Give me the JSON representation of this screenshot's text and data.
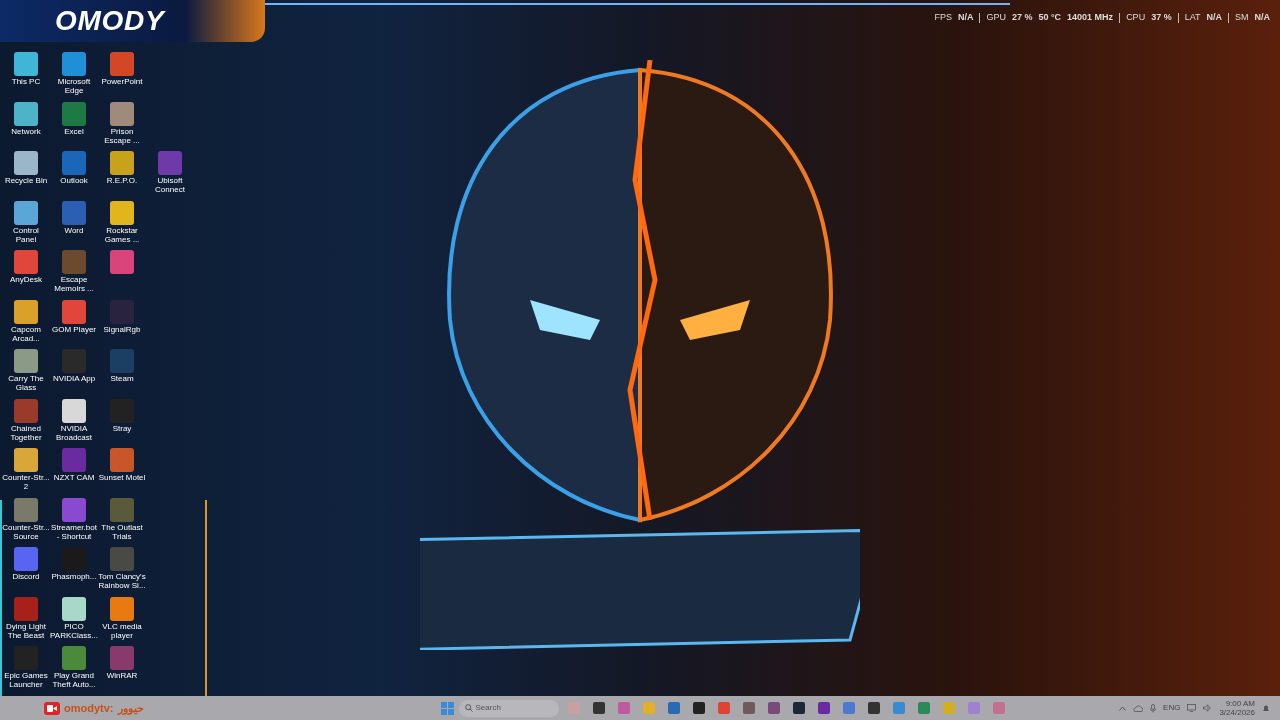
{
  "overlay_logo": {
    "text": "OMODY"
  },
  "stats": [
    {
      "label": "FPS",
      "values": [
        "N/A"
      ]
    },
    {
      "label": "GPU",
      "values": [
        "27 %",
        "50 °C",
        "14001 MHz"
      ]
    },
    {
      "label": "CPU",
      "values": [
        "37 %"
      ]
    },
    {
      "label": "LAT",
      "values": [
        "N/A"
      ]
    },
    {
      "label": "SM",
      "values": [
        "N/A"
      ]
    }
  ],
  "desktop_rows": [
    [
      {
        "label": "This PC",
        "color": "#3fb6d6"
      },
      {
        "label": "Microsoft Edge",
        "color": "#1f8fd6"
      },
      {
        "label": "PowerPoint",
        "color": "#d24726"
      }
    ],
    [
      {
        "label": "Network",
        "color": "#4cb3c9"
      },
      {
        "label": "Excel",
        "color": "#1d7a45"
      },
      {
        "label": "Prison Escape ...",
        "color": "#a08a7a"
      }
    ],
    [
      {
        "label": "Recycle Bin",
        "color": "#9ab6c8"
      },
      {
        "label": "Outlook",
        "color": "#1a66b8"
      },
      {
        "label": "R.E.P.O.",
        "color": "#c8a21a"
      },
      {
        "label": "Ubisoft Connect",
        "color": "#6e3aa8"
      }
    ],
    [
      {
        "label": "Control Panel",
        "color": "#5aa6d6"
      },
      {
        "label": "Word",
        "color": "#2b5fb4"
      },
      {
        "label": "Rockstar Games ...",
        "color": "#e3b51c"
      }
    ],
    [
      {
        "label": "AnyDesk",
        "color": "#e0473a"
      },
      {
        "label": "Escape Memoirs ...",
        "color": "#6b4a2e"
      },
      {
        "color": "#d9447a"
      }
    ],
    [
      {
        "label": "Capcom Arcad...",
        "color": "#d9a12a"
      },
      {
        "label": "GOM Player",
        "color": "#e2463a"
      },
      {
        "label": "SignalRgb",
        "color": "#2a2340"
      }
    ],
    [
      {
        "label": "Carry The Glass",
        "color": "#8a9a86"
      },
      {
        "label": "NVIDIA App",
        "color": "#2a2a2a"
      },
      {
        "label": "Steam",
        "color": "#1b3f63"
      }
    ],
    [
      {
        "label": "Chained Together",
        "color": "#9a3a2a"
      },
      {
        "label": "NVIDIA Broadcast",
        "color": "#d8d8d8"
      },
      {
        "label": "Stray",
        "color": "#222222"
      }
    ],
    [
      {
        "label": "Counter-Str... 2",
        "color": "#d9a63a"
      },
      {
        "label": "NZXT CAM",
        "color": "#6a2aa0"
      },
      {
        "label": "Sunset Motel",
        "color": "#c9552a"
      }
    ],
    [
      {
        "label": "Counter-Str... Source",
        "color": "#7a7a6a"
      },
      {
        "label": "Streamer.bot - Shortcut",
        "color": "#8a4ad0"
      },
      {
        "label": "The Outlast Trials",
        "color": "#5a5a3a"
      }
    ],
    [
      {
        "label": "Discord",
        "color": "#5865f2"
      },
      {
        "label": "Phasmoph...",
        "color": "#1a1a1a"
      },
      {
        "label": "Tom Clancy's Rainbow Si...",
        "color": "#4a4a44"
      }
    ],
    [
      {
        "label": "Dying Light The Beast",
        "color": "#a8201a"
      },
      {
        "label": "PICO PARKClass...",
        "color": "#a8d8c8"
      },
      {
        "label": "VLC media player",
        "color": "#e87a12"
      }
    ],
    [
      {
        "label": "Epic Games Launcher",
        "color": "#222222"
      },
      {
        "label": "Play Grand Theft Auto...",
        "color": "#4a8a3a"
      },
      {
        "label": "WinRAR",
        "color": "#8a3a6a"
      }
    ]
  ],
  "chat": {
    "user": "omodytv:",
    "message": "حيوور"
  },
  "taskbar": {
    "search": {
      "placeholder": "Search"
    },
    "apps": [
      {
        "color": "#c9a0a0"
      },
      {
        "color": "#333333"
      },
      {
        "color": "#c05aa0"
      },
      {
        "color": "#e0b02a"
      },
      {
        "color": "#2a6ab0"
      },
      {
        "color": "#222222"
      },
      {
        "color": "#dd4433"
      },
      {
        "color": "#6e5a5a"
      },
      {
        "color": "#7a4a7a"
      },
      {
        "color": "#1b2838"
      },
      {
        "color": "#6a2aa0"
      },
      {
        "color": "#4a7ad0"
      },
      {
        "color": "#333333"
      },
      {
        "color": "#3a8ad0"
      },
      {
        "color": "#2a8a5a"
      },
      {
        "color": "#d0b020"
      },
      {
        "color": "#a080d0"
      },
      {
        "color": "#c07090"
      }
    ],
    "language": "ENG",
    "time": "9:00 AM",
    "date": "3/24/2026"
  }
}
